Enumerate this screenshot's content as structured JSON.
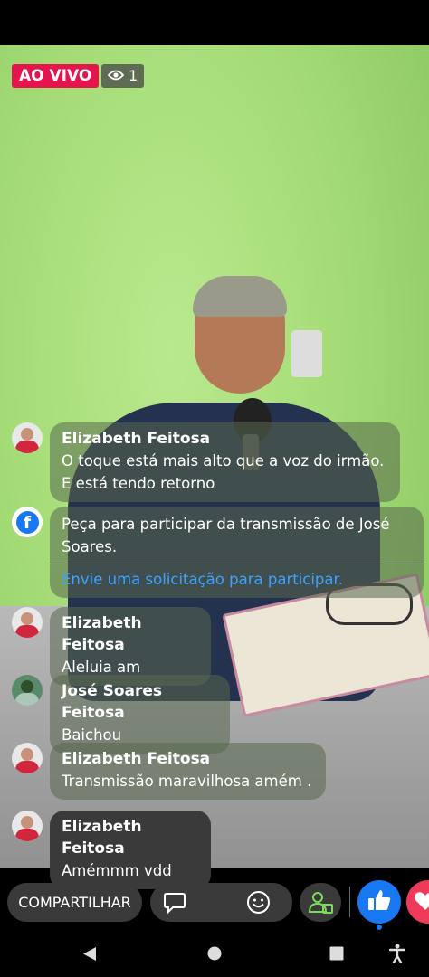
{
  "live": {
    "label": "AO VIVO",
    "viewers": "1"
  },
  "comments": [
    {
      "name": "Elizabeth Feitosa",
      "text": "O toque está mais alto que a voz do irmão. E está tendo retorno"
    },
    {
      "name": "Elizabeth Feitosa",
      "text": "Aleluia am"
    },
    {
      "name": "José Soares Feitosa",
      "text": "Baichou"
    },
    {
      "name": "Elizabeth Feitosa",
      "text": "Transmissão maravilhosa amém ."
    },
    {
      "name": "Elizabeth Feitosa",
      "text": "Amémmm vdd"
    }
  ],
  "join_prompt": {
    "text": "Peça para participar da transmissão de José Soares.",
    "link": "Envie uma solicitação para participar."
  },
  "actions": {
    "share_label": "COMPARTILHAR"
  },
  "colors": {
    "live_red": "#e4154e",
    "facebook_blue": "#1877f2",
    "link_blue": "#3ea2ff",
    "love_red": "#f03a5a"
  },
  "icons": [
    "eye-icon",
    "facebook-icon",
    "comment-icon",
    "emoji-icon",
    "guest-request-icon",
    "like-icon",
    "love-icon",
    "nav-back-icon",
    "nav-home-icon",
    "nav-recents-icon",
    "accessibility-icon"
  ]
}
